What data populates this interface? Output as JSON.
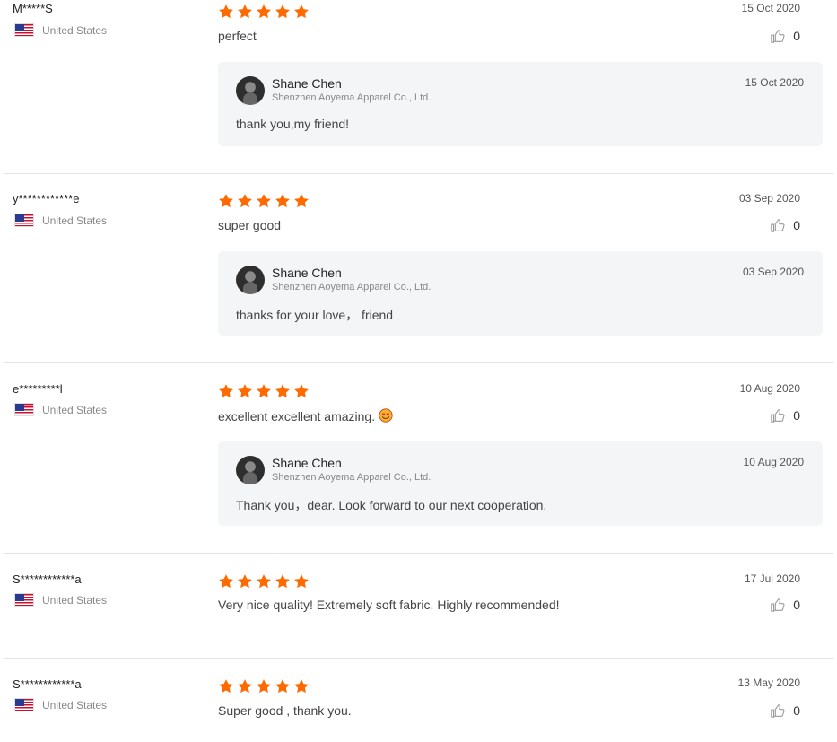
{
  "accent_color": "#ff6a00",
  "reviews": [
    {
      "name": "M*****S",
      "country": "United States",
      "rating": 5,
      "text": "perfect",
      "date": "15 Oct 2020",
      "likes": "0",
      "reply": {
        "name": "Shane Chen",
        "company": "Shenzhen Aoyema Apparel Co., Ltd.",
        "date": "15 Oct 2020",
        "text": "thank you,my friend!"
      }
    },
    {
      "name": "y************e",
      "country": "United States",
      "rating": 5,
      "text": "super good",
      "date": "03 Sep 2020",
      "likes": "0",
      "reply": {
        "name": "Shane Chen",
        "company": "Shenzhen Aoyema Apparel Co., Ltd.",
        "date": "03 Sep 2020",
        "text": "thanks for your love， friend"
      }
    },
    {
      "name": "e*********l",
      "country": "United States",
      "rating": 5,
      "text": "excellent excellent amazing.",
      "text_emoji": "smiling-face-with-heart-eyes",
      "date": "10 Aug 2020",
      "likes": "0",
      "reply": {
        "name": "Shane Chen",
        "company": "Shenzhen Aoyema Apparel Co., Ltd.",
        "date": "10 Aug 2020",
        "text": "Thank you，dear. Look forward to our next cooperation."
      }
    },
    {
      "name": "S************a",
      "country": "United States",
      "rating": 5,
      "text": "Very nice quality! Extremely soft fabric. Highly recommended!",
      "date": "17 Jul 2020",
      "likes": "0"
    },
    {
      "name": "S************a",
      "country": "United States",
      "rating": 5,
      "text": "Super good , thank you.",
      "date": "13 May 2020",
      "likes": "0"
    }
  ]
}
